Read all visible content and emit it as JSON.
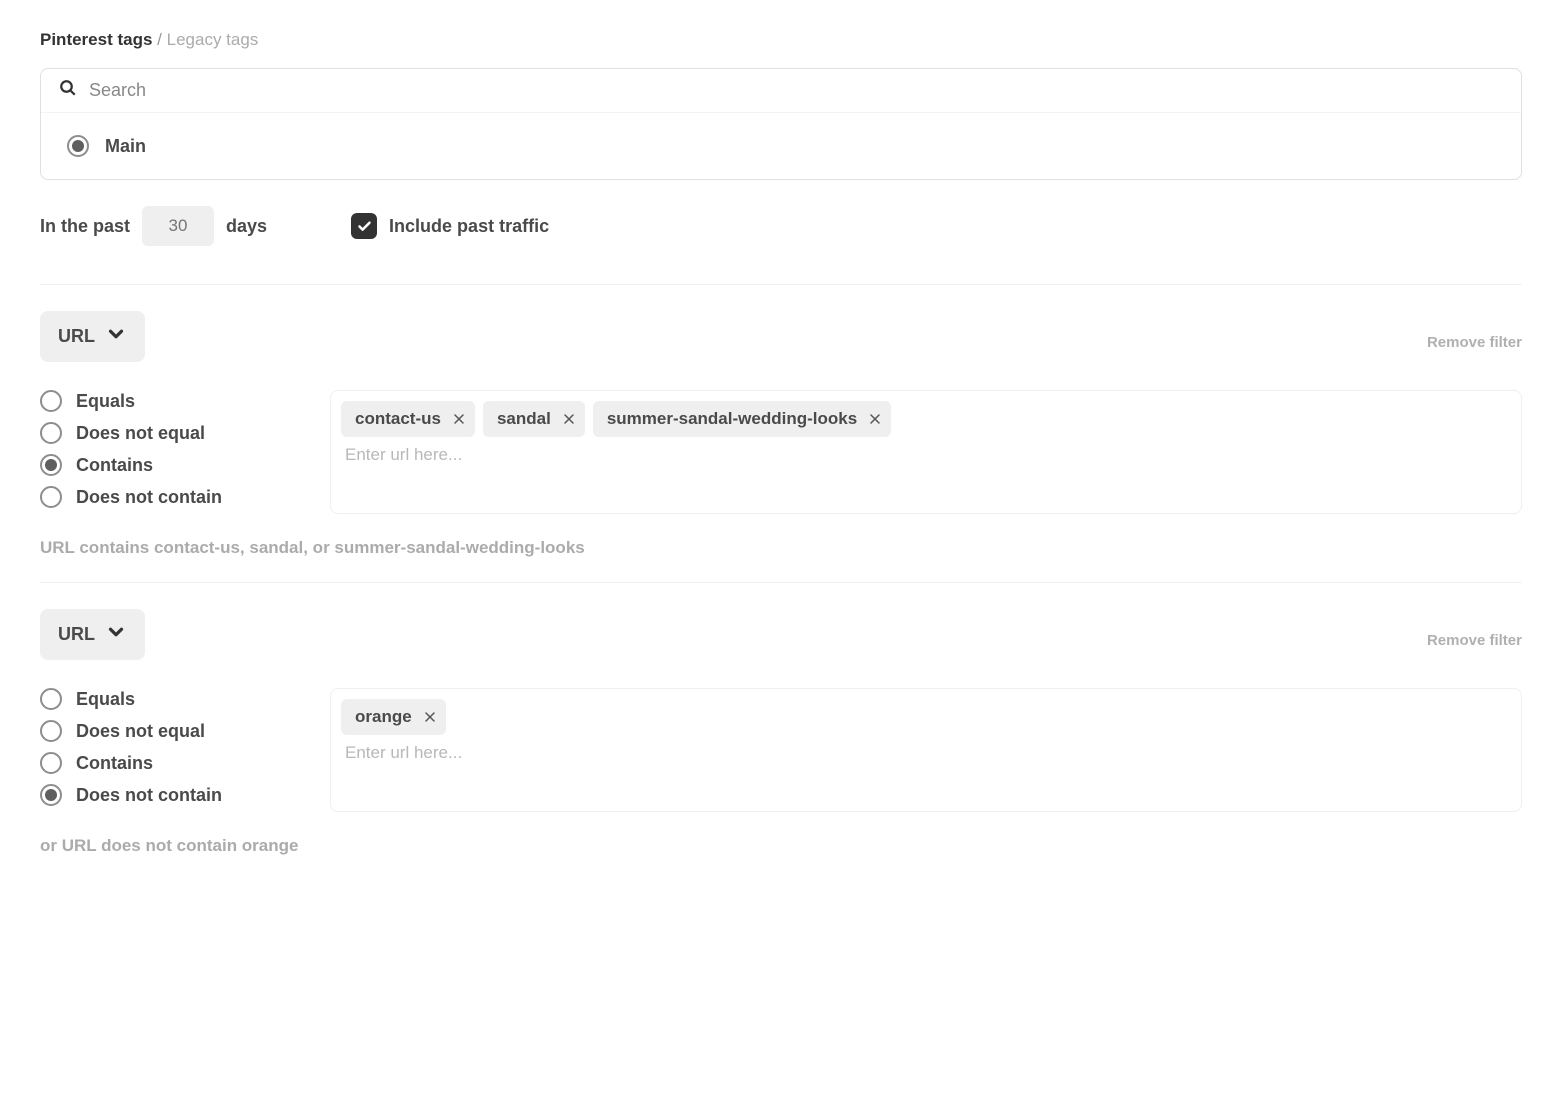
{
  "breadcrumb": {
    "root": "Pinterest tags",
    "current": "Legacy tags"
  },
  "search": {
    "placeholder": "Search"
  },
  "tags": [
    {
      "label": "Main",
      "selected": true
    }
  ],
  "past": {
    "prefix": "In the past",
    "value": "30",
    "suffix": "days",
    "include_label": "Include past traffic",
    "include_checked": true
  },
  "operators": [
    "Equals",
    "Does not equal",
    "Contains",
    "Does not contain"
  ],
  "url_placeholder": "Enter url here...",
  "remove_label": "Remove filter",
  "filters": [
    {
      "type": "URL",
      "selected_op": "Contains",
      "chips": [
        "contact-us",
        "sandal",
        "summer-sandal-wedding-looks"
      ],
      "summary": "URL contains contact-us, sandal, or summer-sandal-wedding-looks"
    },
    {
      "type": "URL",
      "selected_op": "Does not contain",
      "chips": [
        "orange"
      ],
      "summary": "or URL does not contain orange"
    }
  ]
}
